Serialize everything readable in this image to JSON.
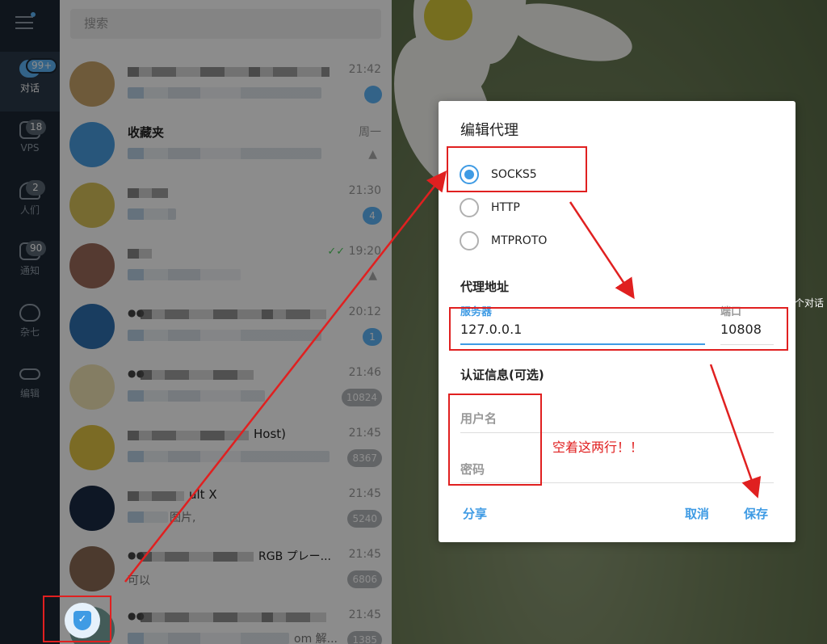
{
  "nav": {
    "items": [
      {
        "label": "对话",
        "badge": "99+",
        "icon": "chat-bubbles-icon"
      },
      {
        "label": "VPS",
        "badge": "18",
        "icon": "folder-icon"
      },
      {
        "label": "人们",
        "badge": "2",
        "icon": "people-icon"
      },
      {
        "label": "通知",
        "badge": "90",
        "icon": "megaphone-icon"
      },
      {
        "label": "杂七",
        "badge": "",
        "icon": "cat-icon"
      },
      {
        "label": "编辑",
        "badge": "",
        "icon": "sliders-icon"
      }
    ]
  },
  "search": {
    "placeholder": "搜索"
  },
  "chats": [
    {
      "name": "",
      "time": "21:42",
      "badge": ""
    },
    {
      "name": "收藏夹",
      "time": "周一",
      "badge": ""
    },
    {
      "name": "",
      "time": "21:30",
      "badge": "4"
    },
    {
      "name": "",
      "time": "19:20",
      "badge": ""
    },
    {
      "name": "",
      "time": "20:12",
      "badge": "1"
    },
    {
      "name": "",
      "time": "21:46",
      "badge": "10824"
    },
    {
      "name": "",
      "name_suffix": "Host)",
      "time": "21:45",
      "badge": "8367"
    },
    {
      "name": "",
      "name_suffix": "ult X",
      "time": "21:45",
      "badge": "5240"
    },
    {
      "name": "",
      "name_suffix": "RGB プレー...",
      "preview": "可以",
      "time": "21:45",
      "badge": "6806"
    },
    {
      "name": "",
      "preview_suffix": "om 解...",
      "time": "21:45",
      "badge": "1385"
    }
  ],
  "chat_extra": {
    "preview_fragment_7": "图片,"
  },
  "dialog": {
    "title": "编辑代理",
    "proxy_types": [
      "SOCKS5",
      "HTTP",
      "MTPROTO"
    ],
    "selected_type": "SOCKS5",
    "address_section": "代理地址",
    "server_label": "服务器",
    "server_value": "127.0.0.1",
    "port_label": "端口",
    "port_value": "10808",
    "auth_section": "认证信息(可选)",
    "username_placeholder": "用户名",
    "password_placeholder": "密码",
    "share_label": "分享",
    "cancel_label": "取消",
    "save_label": "保存"
  },
  "annotation": {
    "note": "空着这两行！！",
    "partial_text": "个对话"
  },
  "colors": {
    "accent": "#3f9be4",
    "annotation_red": "#e02020",
    "nav_bg": "#1c2733"
  }
}
